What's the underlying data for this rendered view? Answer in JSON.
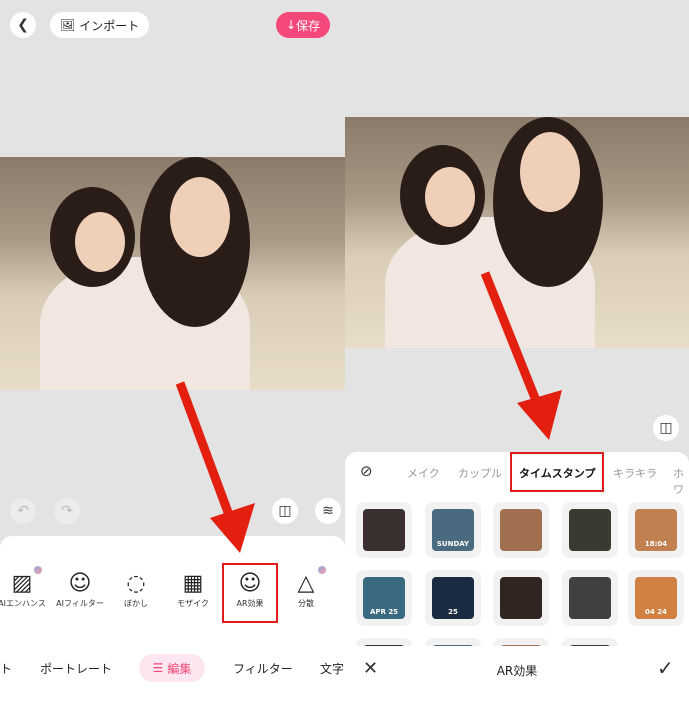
{
  "left": {
    "import_label": "インポート",
    "save_label": "保存",
    "tools": [
      {
        "label": "AIエンハンス",
        "icon": "ai-enhance-icon"
      },
      {
        "label": "AIフィルター",
        "icon": "ai-filter-icon"
      },
      {
        "label": "ぼかし",
        "icon": "blur-icon"
      },
      {
        "label": "モザイク",
        "icon": "mosaic-icon"
      },
      {
        "label": "AR効果",
        "icon": "ar-face-icon"
      },
      {
        "label": "分散",
        "icon": "disperse-icon"
      }
    ],
    "tabs": [
      "ト",
      "ポートレート",
      "編集",
      "フィルター",
      "文字"
    ],
    "active_tab": "編集"
  },
  "right": {
    "categories": [
      "メイク",
      "カップル",
      "タイムスタンプ",
      "キラキラ",
      "ホワ"
    ],
    "active_category": "タイムスタンプ",
    "thumbs": [
      "",
      "SUNDAY",
      "",
      "",
      "18:04",
      "APR 25",
      "25",
      "",
      "",
      "04 24"
    ],
    "title": "AR効果"
  },
  "colors": {
    "accent": "#f5487a",
    "highlight": "#e01b1b"
  }
}
